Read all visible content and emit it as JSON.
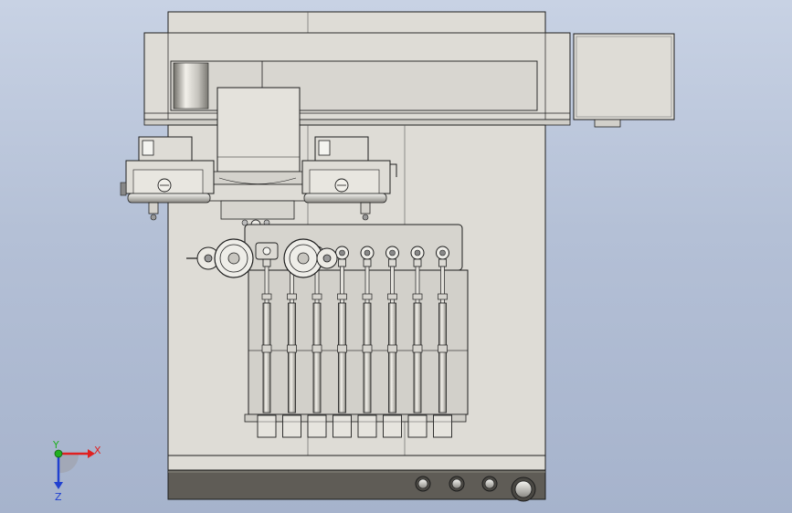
{
  "viewport": {
    "background_top": "#c8d2e4",
    "background_bottom": "#a6b3cc"
  },
  "model": {
    "body_color": "#dedcd6",
    "panel_color": "#d2d0ca",
    "base_color": "#5f5c56",
    "edge_color": "#1e1e1e",
    "shade_color": "#a8a6a0",
    "needle_count": 8
  },
  "triad": {
    "x_label": "X",
    "y_label": "Y",
    "z_label": "Z",
    "x_color": "#e02020",
    "y_color": "#20b020",
    "z_color": "#2040d0"
  }
}
